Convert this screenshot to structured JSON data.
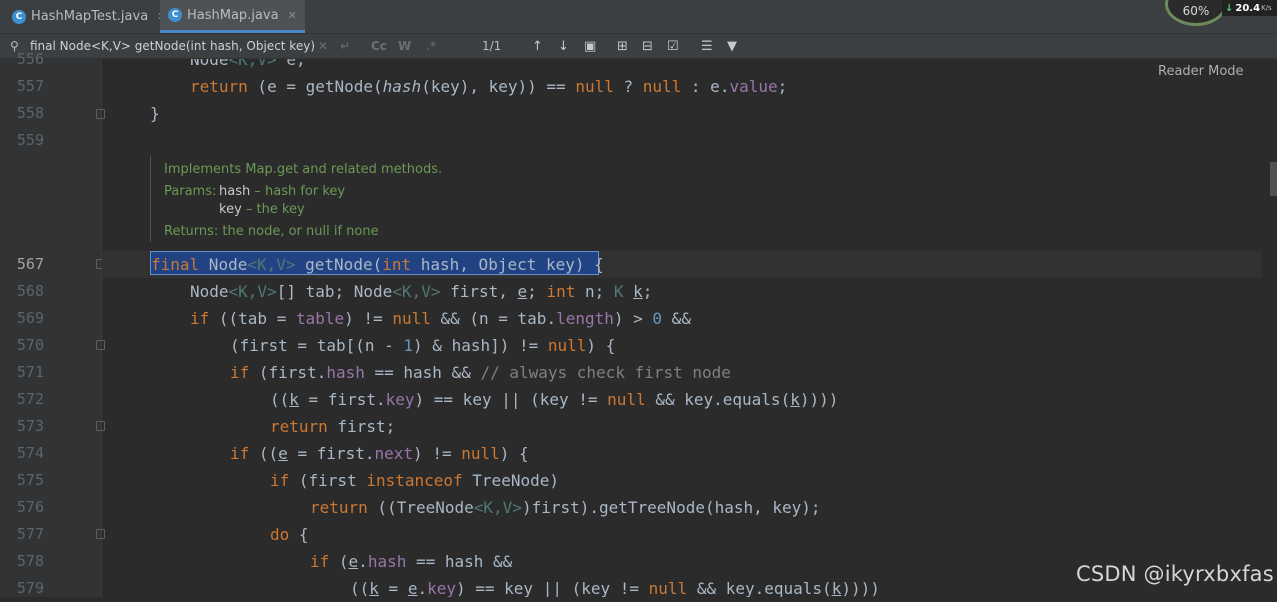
{
  "tabs": [
    {
      "label": "HashMapTest.java",
      "icon": "java-class-icon",
      "active": false
    },
    {
      "label": "HashMap.java",
      "icon": "java-class-icon",
      "active": true
    }
  ],
  "perf_widget": {
    "percent": "60%",
    "net_speed": "20.4",
    "net_unit": "K/s"
  },
  "find_bar": {
    "query": "final Node<K,V> getNode(int hash, Object key)",
    "cc_label": "Cc",
    "w_label": "W",
    "match_count": "1/1"
  },
  "editor": {
    "reader_mode_label": "Reader Mode",
    "doc_comment": {
      "summary": "Implements Map.get and related methods.",
      "params_label": "Params:",
      "param1_name": "hash",
      "param1_desc": " – hash for key",
      "param2_name": "key",
      "param2_desc": " – the key",
      "returns": "Returns: the node, or null if none"
    },
    "line_numbers": [
      "557",
      "558",
      "559",
      "567",
      "568",
      "569",
      "570",
      "571",
      "572",
      "573",
      "574",
      "575",
      "576",
      "577",
      "578",
      "579"
    ],
    "partial_line_number": "556"
  },
  "watermark": "CSDN @ikyrxbxfas",
  "colors": {
    "keyword": "#cc7832",
    "field": "#9876aa",
    "number": "#6897bb",
    "doc": "#6a9955",
    "selection": "#214283"
  }
}
